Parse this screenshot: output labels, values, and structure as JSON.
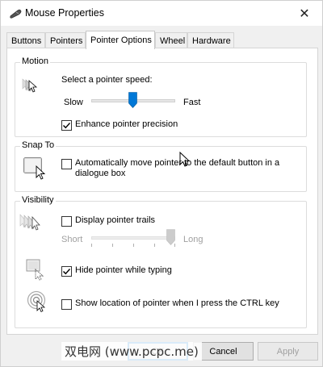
{
  "window": {
    "title": "Mouse Properties",
    "close_glyph": "✕"
  },
  "tabs": [
    {
      "label": "Buttons",
      "active": false
    },
    {
      "label": "Pointers",
      "active": false
    },
    {
      "label": "Pointer Options",
      "active": true
    },
    {
      "label": "Wheel",
      "active": false
    },
    {
      "label": "Hardware",
      "active": false
    }
  ],
  "motion": {
    "title": "Motion",
    "prompt": "Select a pointer speed:",
    "slow_label": "Slow",
    "fast_label": "Fast",
    "speed_fraction": 0.5,
    "enhance_label": "Enhance pointer precision",
    "enhance_checked": true,
    "icon": "pointer-speed-icon"
  },
  "snap_to": {
    "title": "Snap To",
    "label": "Automatically move pointer to the default button in a dialogue box",
    "line1": "Automatically move pointer to the default button in a",
    "line2": "dialogue box",
    "checked": false,
    "icon": "snap-to-button-icon"
  },
  "visibility": {
    "title": "Visibility",
    "trails_label": "Display pointer trails",
    "trails_checked": false,
    "short_label": "Short",
    "long_label": "Long",
    "trail_fraction": 1.0,
    "hide_label": "Hide pointer while typing",
    "hide_checked": true,
    "ctrl_label": "Show location of pointer when I press the CTRL key",
    "ctrl_checked": false
  },
  "buttons": {
    "ok": "OK",
    "cancel": "Cancel",
    "apply": "Apply"
  },
  "watermark": "双电网 (www.pcpc.me)",
  "colors": {
    "accent": "#0078d7",
    "disabled_text": "#a0a0a0"
  }
}
